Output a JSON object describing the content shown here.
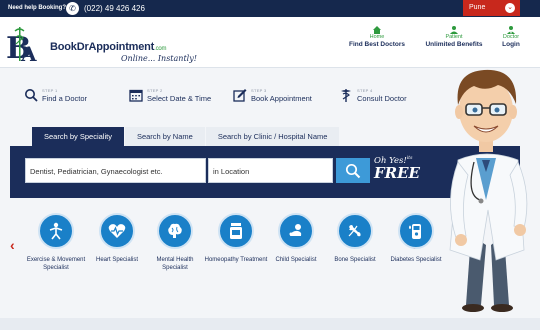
{
  "topbar": {
    "help_text": "Need help Booking?",
    "phone": "(022) 49 426 426",
    "city": "Pune"
  },
  "header": {
    "logo_text": "BookDrAppointment",
    "logo_suffix": ".com",
    "tagline": "Online... Instantly!",
    "nav": [
      {
        "small": "Home",
        "big": "Find Best Doctors",
        "icon": "home-icon"
      },
      {
        "small": "Patient",
        "big": "Unlimited Benefits",
        "icon": "patient-icon"
      },
      {
        "small": "Doctor",
        "big": "Login",
        "icon": "doctor-icon"
      }
    ]
  },
  "steps": [
    {
      "label": "STEP 1",
      "title": "Find a Doctor",
      "icon": "search-icon"
    },
    {
      "label": "STEP 2",
      "title": "Select Date & Time",
      "icon": "calendar-icon"
    },
    {
      "label": "STEP 3",
      "title": "Book Appointment",
      "icon": "book-icon"
    },
    {
      "label": "STEP 4",
      "title": "Consult Doctor",
      "icon": "caduceus-icon"
    }
  ],
  "tabs": [
    "Search by Speciality",
    "Search by Name",
    "Search by Clinic / Hospital Name"
  ],
  "search": {
    "speciality_placeholder": "Dentist, Pediatrician, Gynaecologist etc.",
    "location_placeholder": "in Location",
    "promo_line1": "Oh Yes!",
    "promo_its": "its",
    "promo_line2": "FREE"
  },
  "specialities": [
    {
      "name": "Exercise & Movement Specialist",
      "icon": "exercise-icon"
    },
    {
      "name": "Heart Specialist",
      "icon": "heart-icon"
    },
    {
      "name": "Mental Health Specialist",
      "icon": "brain-icon"
    },
    {
      "name": "Homeopathy Treatment",
      "icon": "medicine-jar-icon"
    },
    {
      "name": "Child Specialist",
      "icon": "baby-icon"
    },
    {
      "name": "Bone Specialist",
      "icon": "bone-icon"
    },
    {
      "name": "Diabetes Specialist",
      "icon": "glucose-meter-icon"
    }
  ],
  "colors": {
    "navy": "#1b2d5a",
    "red": "#c8281c",
    "blue": "#1a80c8",
    "green": "#2e9a3e"
  }
}
